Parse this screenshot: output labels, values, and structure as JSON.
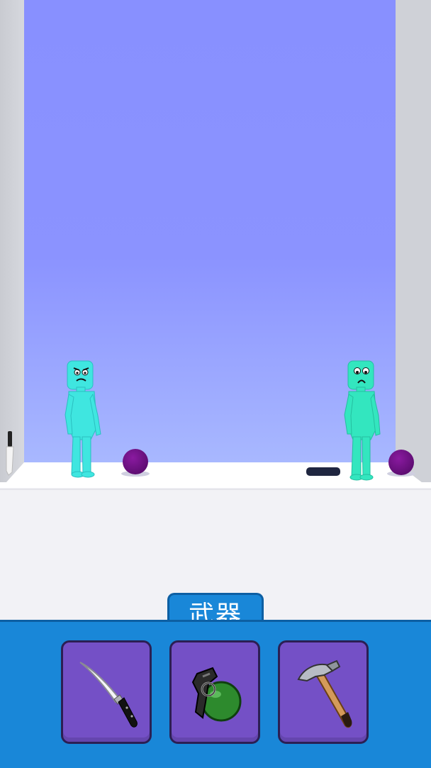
{
  "weapons_panel": {
    "title": "武器",
    "items": [
      {
        "icon": "knife-icon"
      },
      {
        "icon": "grenade-icon"
      },
      {
        "icon": "hammer-icon"
      }
    ]
  },
  "scene": {
    "characters": [
      {
        "icon": "angry-ragdoll-character",
        "color": "#3fe6e0"
      },
      {
        "icon": "scared-ragdoll-character",
        "color": "#33e6bf"
      }
    ],
    "props": [
      {
        "icon": "knife-icon"
      },
      {
        "icon": "purple-ball-icon"
      },
      {
        "icon": "purple-ball-icon"
      },
      {
        "icon": "dark-pad-icon"
      }
    ]
  },
  "colors": {
    "sky_top": "#8890ff",
    "sky_bottom": "#a7b7ff",
    "floor": "#f4f4f8",
    "panel": "#1987d8",
    "slot": "#7450c6"
  }
}
